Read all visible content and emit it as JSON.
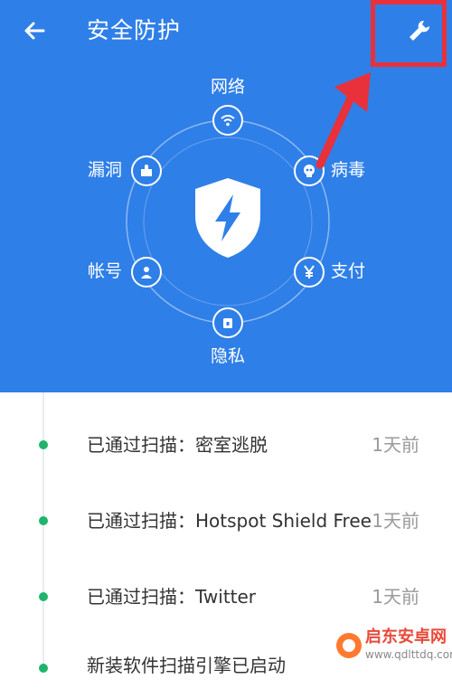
{
  "header": {
    "title": "安全防护",
    "back_icon": "back-arrow-icon",
    "settings_icon": "wrench-icon"
  },
  "hero": {
    "nodes": [
      {
        "label": "网络",
        "icon": "wifi-icon"
      },
      {
        "label": "病毒",
        "icon": "skull-icon"
      },
      {
        "label": "支付",
        "icon": "yen-icon"
      },
      {
        "label": "隐私",
        "icon": "lock-icon"
      },
      {
        "label": "帐号",
        "icon": "person-icon"
      },
      {
        "label": "漏洞",
        "icon": "puzzle-icon"
      }
    ],
    "center_icon": "shield-lightning-icon"
  },
  "scan_list": [
    {
      "text": "已通过扫描：密室逃脱",
      "time": "1天前"
    },
    {
      "text": "已通过扫描：Hotspot Shield Free",
      "time": "1天前"
    },
    {
      "text": "已通过扫描：Twitter",
      "time": "1天前"
    },
    {
      "text": "新装软件扫描引擎已启动",
      "time": ""
    }
  ],
  "watermark": {
    "name": "启东安卓网",
    "url": "www.qdlttdq.com"
  },
  "colors": {
    "hero_bg": "#2f7fe8",
    "dot_green": "#1fb46b",
    "annotation_red": "#e8313a"
  }
}
